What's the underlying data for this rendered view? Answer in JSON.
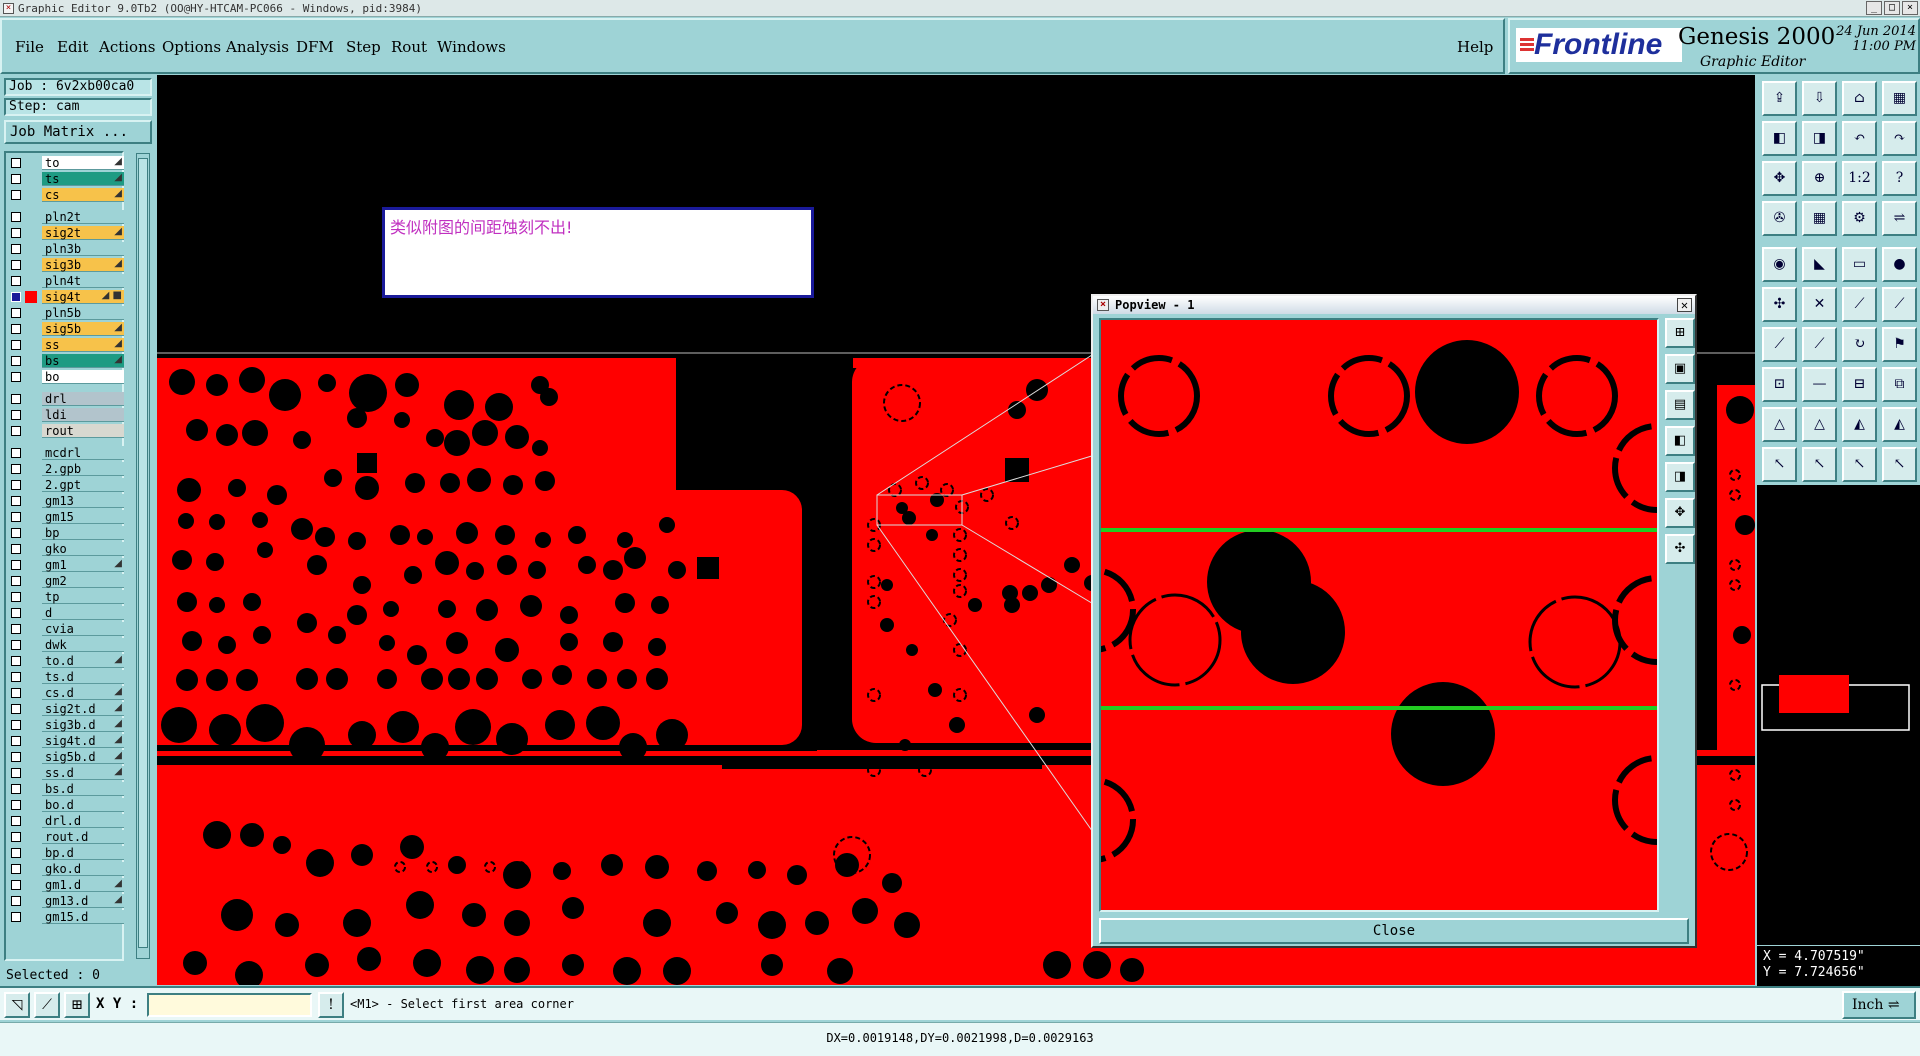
{
  "window": {
    "title": "Graphic Editor 9.0Tb2 (OO@HY-HTCAM-PC066 - Windows, pid:3984)"
  },
  "menu": [
    "File",
    "Edit",
    "Actions",
    "Options",
    "Analysis",
    "DFM",
    "Step",
    "Rout",
    "Windows"
  ],
  "help_label": "Help",
  "brand": {
    "logo": "Frontline",
    "product": "Genesis 2000",
    "subtitle": "Graphic Editor",
    "date": "24 Jun 2014",
    "time": "11:00 PM"
  },
  "job": {
    "job_label": "Job : 6v2xb00ca0",
    "step_label": "Step: cam",
    "matrix_button": "Job Matrix ..."
  },
  "layers": [
    {
      "name": "to",
      "color": "#ffffff",
      "flag": "◢"
    },
    {
      "name": "ts",
      "color": "#1e9b83",
      "flag": "◢"
    },
    {
      "name": "cs",
      "color": "#f7c24a",
      "flag": "◢"
    },
    {
      "name": "pln2t",
      "color": "",
      "flag": ""
    },
    {
      "name": "sig2t",
      "color": "#f7c24a",
      "flag": "◢"
    },
    {
      "name": "pln3b",
      "color": "",
      "flag": ""
    },
    {
      "name": "sig3b",
      "color": "#f7c24a",
      "flag": "◢"
    },
    {
      "name": "pln4t",
      "color": "",
      "flag": ""
    },
    {
      "name": "sig4t",
      "color": "#f7c24a",
      "flag": "◢ ■",
      "active": true
    },
    {
      "name": "pln5b",
      "color": "",
      "flag": ""
    },
    {
      "name": "sig5b",
      "color": "#f7c24a",
      "flag": "◢"
    },
    {
      "name": "ss",
      "color": "#f7c24a",
      "flag": "◢"
    },
    {
      "name": "bs",
      "color": "#1e9b83",
      "flag": "◢"
    },
    {
      "name": "bo",
      "color": "#ffffff",
      "flag": ""
    },
    {
      "name": "drl",
      "color": "#b2c4cc",
      "flag": ""
    },
    {
      "name": "ldi",
      "color": "#b2c4cc",
      "flag": ""
    },
    {
      "name": "rout",
      "color": "#d8d8d0",
      "flag": ""
    },
    {
      "name": "mcdrl",
      "color": "",
      "flag": ""
    },
    {
      "name": "2.gpb",
      "color": "",
      "flag": ""
    },
    {
      "name": "2.gpt",
      "color": "",
      "flag": ""
    },
    {
      "name": "gm13",
      "color": "",
      "flag": ""
    },
    {
      "name": "gm15",
      "color": "",
      "flag": ""
    },
    {
      "name": "bp",
      "color": "",
      "flag": ""
    },
    {
      "name": "gko",
      "color": "",
      "flag": ""
    },
    {
      "name": "gm1",
      "color": "",
      "flag": "◢"
    },
    {
      "name": "gm2",
      "color": "",
      "flag": ""
    },
    {
      "name": "tp",
      "color": "",
      "flag": ""
    },
    {
      "name": "d",
      "color": "",
      "flag": ""
    },
    {
      "name": "cvia",
      "color": "",
      "flag": ""
    },
    {
      "name": "dwk",
      "color": "",
      "flag": ""
    },
    {
      "name": "to.d",
      "color": "",
      "flag": "◢"
    },
    {
      "name": "ts.d",
      "color": "",
      "flag": ""
    },
    {
      "name": "cs.d",
      "color": "",
      "flag": "◢"
    },
    {
      "name": "sig2t.d",
      "color": "",
      "flag": "◢"
    },
    {
      "name": "sig3b.d",
      "color": "",
      "flag": "◢"
    },
    {
      "name": "sig4t.d",
      "color": "",
      "flag": "◢"
    },
    {
      "name": "sig5b.d",
      "color": "",
      "flag": "◢"
    },
    {
      "name": "ss.d",
      "color": "",
      "flag": "◢"
    },
    {
      "name": "bs.d",
      "color": "",
      "flag": ""
    },
    {
      "name": "bo.d",
      "color": "",
      "flag": ""
    },
    {
      "name": "drl.d",
      "color": "",
      "flag": ""
    },
    {
      "name": "rout.d",
      "color": "",
      "flag": ""
    },
    {
      "name": "bp.d",
      "color": "",
      "flag": ""
    },
    {
      "name": "gko.d",
      "color": "",
      "flag": ""
    },
    {
      "name": "gm1.d",
      "color": "",
      "flag": "◢"
    },
    {
      "name": "gm13.d",
      "color": "",
      "flag": "◢"
    },
    {
      "name": "gm15.d",
      "color": "",
      "flag": ""
    }
  ],
  "selected": "Selected : 0",
  "note": "类似附图的间距蚀刻不出!",
  "popview": {
    "title": "Popview - 1",
    "close": "Close"
  },
  "coords": {
    "x": "X = 4.707519\"",
    "y": "Y = 7.724656\""
  },
  "command": {
    "xy_label": "X Y :",
    "xy_value": "",
    "prompt": "<M1> - Select first area corner",
    "units": "Inch"
  },
  "status": {
    "measure": "DX=0.0019148,DY=0.0021998,D=0.0029163"
  },
  "colors": {
    "copper": "#ff0000",
    "panel": "#9ed3d6",
    "highlight": "#22cc22",
    "note_text": "#c030c0"
  },
  "toolbar_icons": [
    "open-icon",
    "save-icon",
    "home-icon",
    "window-icon",
    "undo-icon",
    "redo-icon",
    "layers-icon",
    "snap-icon",
    "fit-icon",
    "zoom-icon",
    "ratio-icon",
    "help-icon",
    "pan-icon",
    "grid-icon",
    "measure-icon",
    "flip-icon",
    "select-icon",
    "route-icon",
    "ruler-icon",
    "circle-icon",
    "node-icon",
    "move-icon",
    "connect-icon",
    "cross-icon",
    "draw-icon",
    "line-icon",
    "rotate-icon",
    "flag-icon",
    "point-icon",
    "dash-icon",
    "align-icon",
    "mirror-icon",
    "arc-icon",
    "trace-icon",
    "arch-icon",
    "bridge-icon",
    "pointer-icon",
    "pointer-alt-icon",
    "pointer-red-icon",
    "pointer-multi-icon"
  ]
}
